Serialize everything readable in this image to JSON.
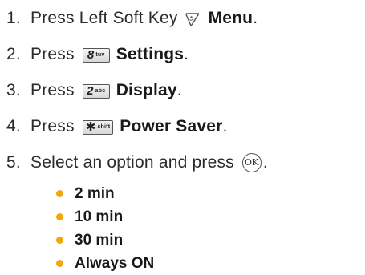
{
  "colors": {
    "bullet": "#f2a80c",
    "text": "#2b2b2b"
  },
  "steps": [
    {
      "number": "1.",
      "prefix": "Press Left Soft Key",
      "icon": "left-soft-key-icon",
      "label": "Menu",
      "suffix": "."
    },
    {
      "number": "2.",
      "prefix": "Press",
      "key": {
        "main": "8",
        "sub": "tuv"
      },
      "label": "Settings",
      "suffix": "."
    },
    {
      "number": "3.",
      "prefix": "Press",
      "key": {
        "main": "2",
        "sub": "abc"
      },
      "label": "Display",
      "suffix": "."
    },
    {
      "number": "4.",
      "prefix": "Press",
      "key": {
        "main": "✱",
        "sub": "shift"
      },
      "label": "Power Saver",
      "suffix": "."
    },
    {
      "number": "5.",
      "prefix": "Select an option and press",
      "okLabel": "OK",
      "suffix": "."
    }
  ],
  "options": [
    "2 min",
    "10 min",
    "30 min",
    "Always ON"
  ]
}
